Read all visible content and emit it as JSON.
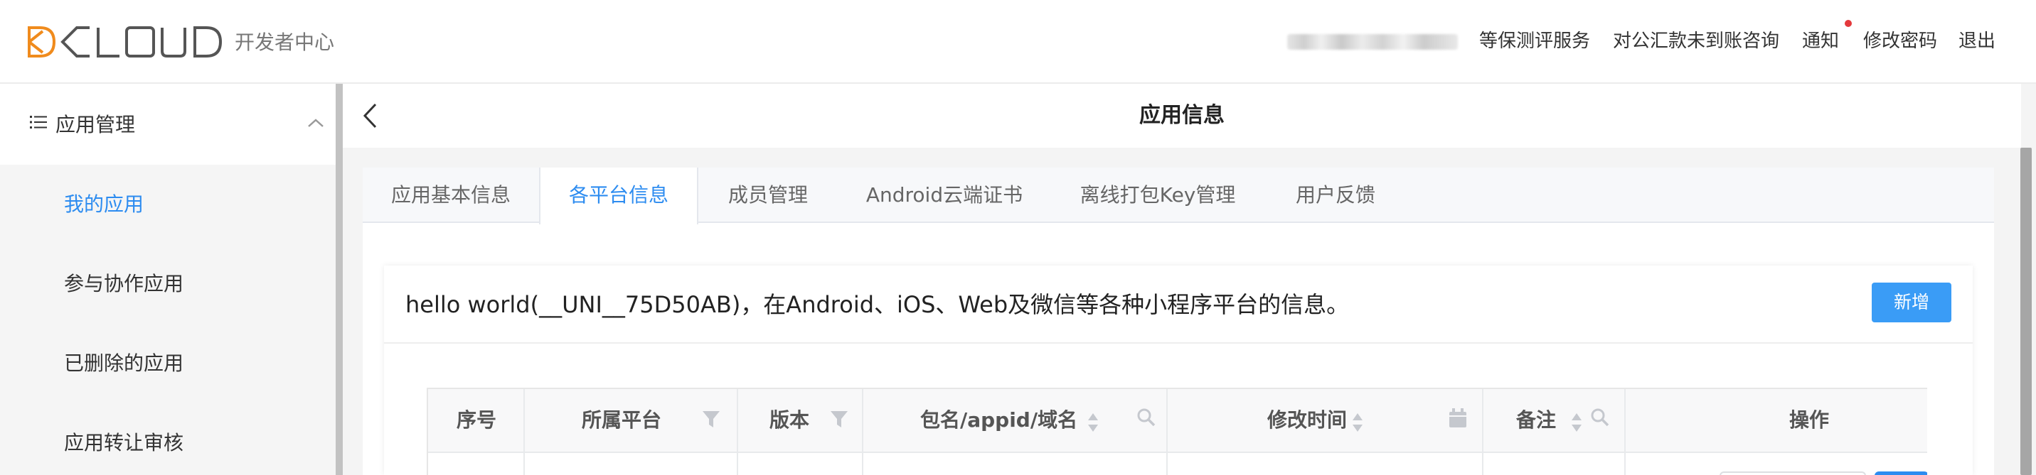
{
  "header": {
    "logo_text": "DCLOUD",
    "logo_subtitle": "开发者中心",
    "nav": [
      "等保测评服务",
      "对公汇款未到账咨询",
      "通知",
      "修改密码",
      "退出"
    ],
    "colors": {
      "logo_orange": "#f08b1d",
      "logo_gray": "#555555",
      "notify_dot": "#e4393c"
    }
  },
  "sidebar": {
    "section_icon": "list-icon",
    "section_label": "应用管理",
    "collapse_icon": "chevron-up-icon",
    "items": [
      {
        "label": "我的应用",
        "active": true
      },
      {
        "label": "参与协作应用",
        "active": false
      },
      {
        "label": "已删除的应用",
        "active": false
      },
      {
        "label": "应用转让审核",
        "active": false
      }
    ]
  },
  "main": {
    "back_icon": "chevron-left-icon",
    "title": "应用信息",
    "tabs": [
      {
        "label": "应用基本信息",
        "active": false
      },
      {
        "label": "各平台信息",
        "active": true
      },
      {
        "label": "成员管理",
        "active": false
      },
      {
        "label": "Android云端证书",
        "active": false
      },
      {
        "label": "离线打包Key管理",
        "active": false
      },
      {
        "label": "用户反馈",
        "active": false
      }
    ],
    "description": "hello world(__UNI__75D50AB)，在Android、iOS、Web及微信等各种小程序平台的信息。",
    "add_button": "新增",
    "accent": "#2d8cf0",
    "table": {
      "columns": [
        {
          "label": "序号",
          "icons": []
        },
        {
          "label": "所属平台",
          "icons": [
            "filter-icon"
          ]
        },
        {
          "label": "版本",
          "icons": [
            "filter-icon"
          ]
        },
        {
          "label": "包名/appid/域名",
          "icons": [
            "sort-icon",
            "search-icon"
          ]
        },
        {
          "label": "修改时间",
          "icons": [
            "sort-icon",
            "calendar-icon"
          ]
        },
        {
          "label": "备注",
          "icons": [
            "sort-icon",
            "search-icon"
          ]
        },
        {
          "label": "操作",
          "icons": []
        }
      ]
    }
  }
}
